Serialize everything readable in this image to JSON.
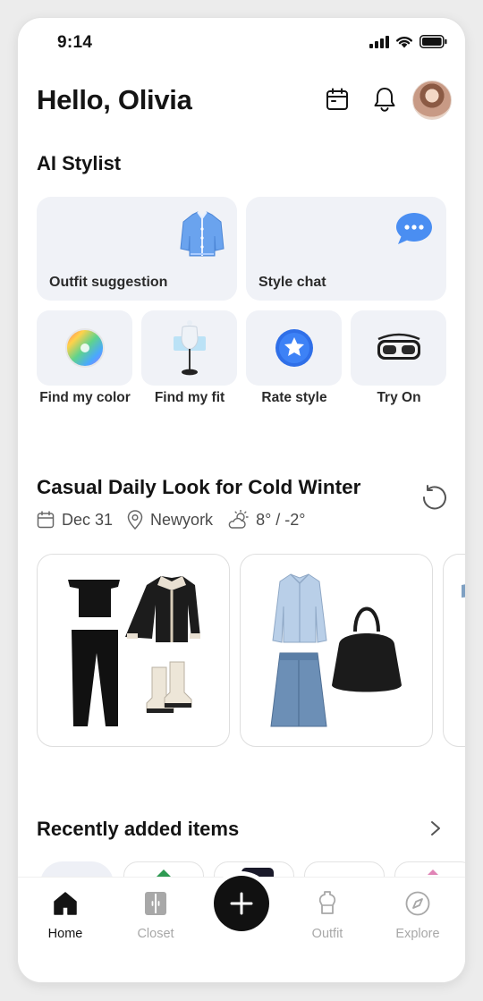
{
  "status_bar": {
    "time": "9:14"
  },
  "header": {
    "greeting": "Hello, Olivia"
  },
  "ai_stylist": {
    "title": "AI Stylist",
    "big_cards": [
      {
        "label": "Outfit suggestion",
        "icon": "cardigan-icon"
      },
      {
        "label": "Style chat",
        "icon": "chat-bubble-icon"
      }
    ],
    "small_cards": [
      {
        "label": "Find my color",
        "icon": "color-wheel-icon"
      },
      {
        "label": "Find my fit",
        "icon": "mannequin-icon"
      },
      {
        "label": "Rate style",
        "icon": "star-badge-icon"
      },
      {
        "label": "Try On",
        "icon": "vr-headset-icon"
      }
    ]
  },
  "daily_look": {
    "title": "Casual Daily Look for Cold Winter",
    "date": "Dec 31",
    "location": "Newyork",
    "weather": "8° / -2°"
  },
  "recent": {
    "title": "Recently added items"
  },
  "nav": {
    "items": [
      {
        "label": "Home",
        "active": true
      },
      {
        "label": "Closet",
        "active": false
      },
      {
        "label": "Outfit",
        "active": false
      },
      {
        "label": "Explore",
        "active": false
      }
    ]
  },
  "colors": {
    "accent_blue": "#3d7cf0",
    "card_bg": "#f0f2f7",
    "text": "#141414",
    "inactive": "#a8a8a8"
  }
}
